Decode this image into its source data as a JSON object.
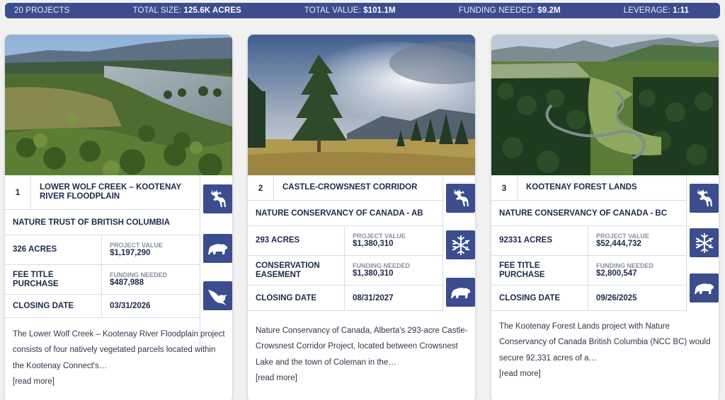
{
  "stats": {
    "projects_count": "20",
    "projects_label": "PROJECTS",
    "size_label": "TOTAL SIZE:",
    "size_value": "125.6K ACRES",
    "value_label": "TOTAL VALUE:",
    "value_value": "$101.1M",
    "funding_label": "FUNDING NEEDED:",
    "funding_value": "$9.2M",
    "leverage_label": "LEVERAGE:",
    "leverage_value": "1:11"
  },
  "cards": [
    {
      "number": "1",
      "title": "LOWER WOLF CREEK – KOOTENAY RIVER FLOODPLAIN",
      "organization": "NATURE TRUST OF BRITISH COLUMBIA",
      "size": "326 ACRES",
      "project_value_label": "PROJECT VALUE",
      "project_value": "$1,197,290",
      "type": "FEE TITLE PURCHASE",
      "funding_needed_label": "FUNDING NEEDED",
      "funding_needed": "$487,988",
      "closing_label": "CLOSING DATE",
      "closing_date": "03/31/2026",
      "description": "The Lower Wolf Creek – Kootenay River Floodplain project consists of four natively vegetated parcels located within the Kootenay Connect's…",
      "read_more": "[read more]",
      "icons": [
        "elk-icon",
        "bear-icon",
        "bird-icon"
      ]
    },
    {
      "number": "2",
      "title": "CASTLE-CROWSNEST CORRIDOR",
      "organization": "NATURE CONSERVANCY OF CANADA - AB",
      "size": "293 ACRES",
      "project_value_label": "PROJECT VALUE",
      "project_value": "$1,380,310",
      "type": "CONSERVATION EASEMENT",
      "funding_needed_label": "FUNDING NEEDED",
      "funding_needed": "$1,380,310",
      "closing_label": "CLOSING DATE",
      "closing_date": "08/31/2027",
      "description": "Nature Conservancy of Canada, Alberta's 293-acre Castle-Crowsnest Corridor Project, located between Crowsnest Lake and the town of Coleman in the…",
      "read_more": "[read more]",
      "icons": [
        "elk-icon",
        "snowflake-icon",
        "bear-icon"
      ]
    },
    {
      "number": "3",
      "title": "KOOTENAY FOREST LANDS",
      "organization": "NATURE CONSERVANCY OF CANADA - BC",
      "size": "92331 ACRES",
      "project_value_label": "PROJECT VALUE",
      "project_value": "$52,444,732",
      "type": "FEE TITLE PURCHASE",
      "funding_needed_label": "FUNDING NEEDED",
      "funding_needed": "$2,800,547",
      "closing_label": "CLOSING DATE",
      "closing_date": "09/26/2025",
      "description": "The Kootenay Forest Lands project with Nature Conservancy of Canada British Columbia (NCC BC) would secure 92,331 acres of a…",
      "read_more": "[read more]",
      "icons": [
        "elk-icon",
        "snowflake-icon",
        "bear-icon"
      ]
    }
  ],
  "colors": {
    "accent": "#3b4d8d",
    "text": "#1e2a4a",
    "background": "#f1f1f1"
  }
}
